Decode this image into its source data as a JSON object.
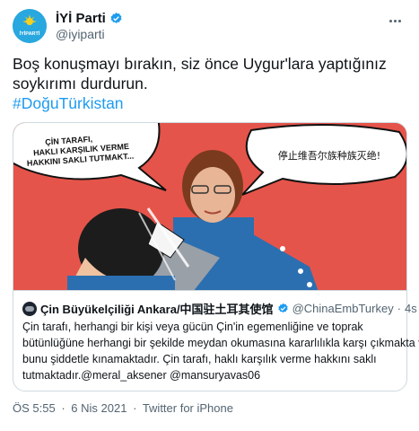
{
  "tweet": {
    "author": {
      "name": "İYİ Parti",
      "handle": "@iyiparti",
      "avatar_text": "İYİPARTİ"
    },
    "more_icon": "more-horizontal-icon",
    "text_lines": [
      "Boş konuşmayı bırakın, siz önce Uygur'lara yaptığınız",
      "soykırımı durdurun."
    ],
    "hashtag": "#DoğuTürkistan",
    "media": {
      "speech_left": [
        "ÇİN TARAFI,",
        "HAKLI KARŞILIK VERME",
        "HAKKINI SAKLI TUTMAKT..."
      ],
      "speech_right": "停止维吾尔族种族灭绝!"
    },
    "quoted": {
      "name": "Çin Büyükelçiliği Ankara/中国驻土耳其使馆",
      "handle": "@ChinaEmbTurkey",
      "dot": "·",
      "time": "4s",
      "lines": [
        "Çin tarafı, herhangi bir kişi veya gücün Çin'in egemenliğine ve toprak",
        "bütünlüğüne herhangi bir şekilde meydan okumasına kararlılıkla karşı çıkmakta ve",
        "bunu şiddetle kınamaktadır. Çin tarafı, haklı karşılık verme hakkını saklı",
        "tutmaktadır.@meral_aksener @mansuryavas06"
      ]
    },
    "meta": {
      "time": "ÖS 5:55",
      "sep1": "·",
      "date": "6 Nis 2021",
      "sep2": "·",
      "source": "Twitter for iPhone"
    },
    "colors": {
      "accent": "#1d9bf0",
      "party_blue": "#29a7df",
      "panel_red": "#e5544a"
    }
  }
}
